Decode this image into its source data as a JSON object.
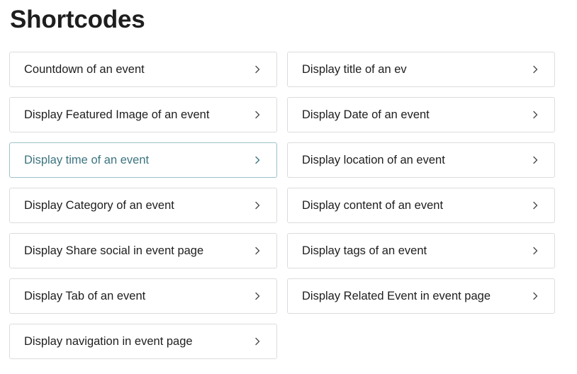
{
  "page": {
    "title": "Shortcodes"
  },
  "colors": {
    "active_accent": "#3d7480",
    "active_border": "#9ec2c9",
    "card_border": "#dcdcde",
    "text": "#1e1e1e"
  },
  "shortcodes": [
    {
      "label": "Countdown of an event",
      "active": false
    },
    {
      "label": "Display title of an ev",
      "active": false
    },
    {
      "label": "Display Featured Image of an event",
      "active": false
    },
    {
      "label": "Display Date of an event",
      "active": false
    },
    {
      "label": "Display time of an event",
      "active": true
    },
    {
      "label": "Display location of an event",
      "active": false
    },
    {
      "label": "Display Category of an event",
      "active": false
    },
    {
      "label": "Display content of an event",
      "active": false
    },
    {
      "label": "Display Share social in event page",
      "active": false
    },
    {
      "label": "Display tags of an event",
      "active": false
    },
    {
      "label": "Display Tab of an event",
      "active": false
    },
    {
      "label": "Display Related Event in event page",
      "active": false
    },
    {
      "label": "Display navigation in event page",
      "active": false
    }
  ],
  "icons": {
    "card_arrow": "chevron-right-icon"
  }
}
